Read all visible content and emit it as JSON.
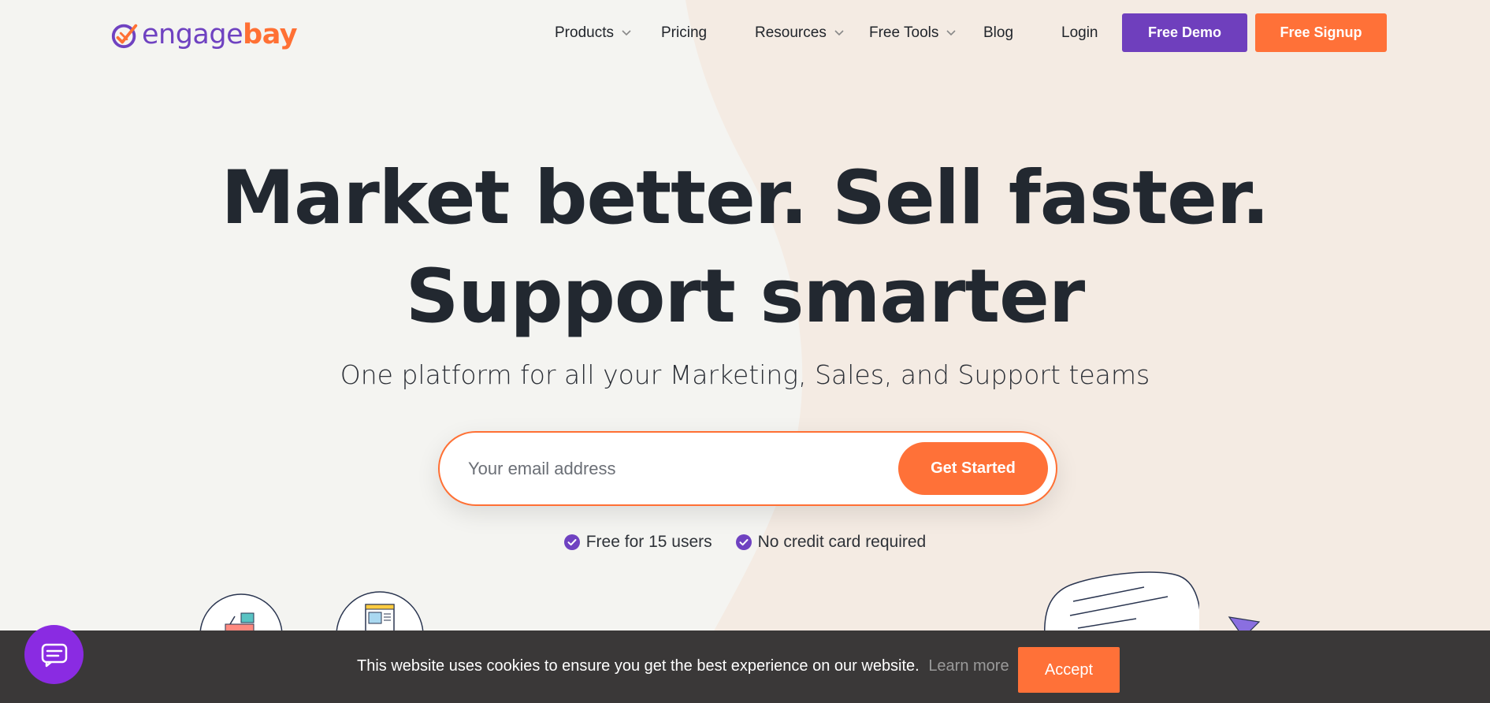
{
  "colors": {
    "brand_purple": "#6f42c1",
    "brand_orange": "#ff7034",
    "cookie_bg": "#3a3838",
    "chat_purple": "#8a2be2"
  },
  "logo": {
    "part1": "engage",
    "part2": "bay"
  },
  "nav": {
    "products": "Products",
    "pricing": "Pricing",
    "resources": "Resources",
    "free_tools": "Free Tools",
    "blog": "Blog",
    "login": "Login",
    "free_demo": "Free Demo",
    "free_signup": "Free Signup"
  },
  "hero": {
    "title_line1": "Market better. Sell faster.",
    "title_line2": "Support smarter",
    "subtitle": "One platform for all your Marketing, Sales, and Support teams",
    "email_placeholder": "Your email address",
    "cta": "Get Started",
    "features": [
      "Free for 15 users",
      "No credit card required"
    ]
  },
  "cookie": {
    "message": "This website uses cookies to ensure you get the best experience on our website.",
    "learn_more": "Learn more",
    "accept": "Accept"
  },
  "icons": {
    "chevron": "chevron-down-icon",
    "check": "check-circle-icon",
    "chat": "chat-icon"
  }
}
